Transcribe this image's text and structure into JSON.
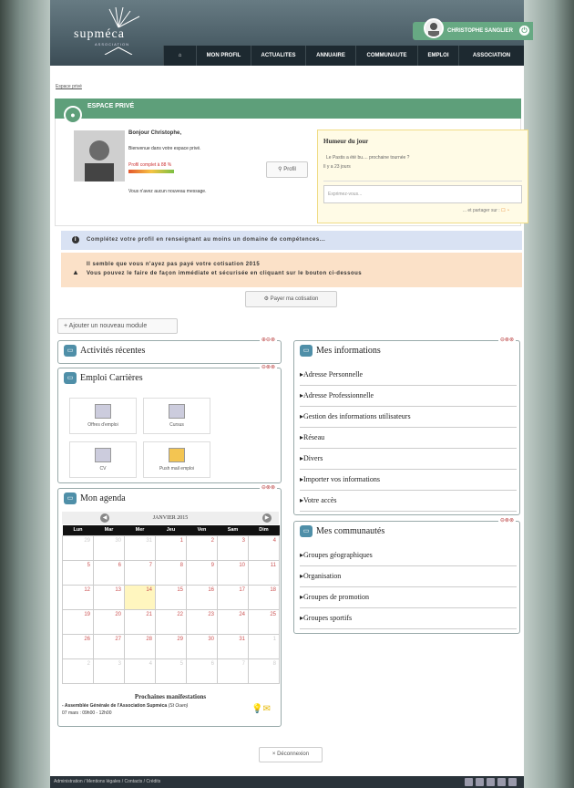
{
  "header": {
    "logo_text": "supméca",
    "logo_sub": "ASSOCIATION",
    "user_name": "CHRISTOPHE SANGLIER"
  },
  "nav": [
    "MON PROFIL",
    "ACTUALITES",
    "ANNUAIRE",
    "COMMUNAUTE",
    "EMPLOI",
    "ASSOCIATION"
  ],
  "breadcrumb": "Espace privé",
  "band_title": "ESPACE PRIVÉ",
  "welcome": {
    "hello": "Bonjour Christophe,",
    "text": "Bienvenue dans votre espace privé.",
    "profile": "Profil complet à 88 %",
    "profile_value": 0.88,
    "messages": "Vous n'avez aucun nouveau message.",
    "profil_btn": "Profil"
  },
  "mood": {
    "title": "Humeur du jour",
    "line1": "Le Pastis a été bu.... prochaine tournée ?",
    "line2": "Il y a 23 jours",
    "placeholder": "Exprimez-vous...",
    "share": "... et partager sur :"
  },
  "info": "Complétez votre profil en renseignant au moins un domaine de compétences...",
  "warn": {
    "a": "Il semble que vous n'ayez pas payé votre cotisation 2015",
    "b": "Vous pouvez le faire de façon immédiate et sécurisée en cliquant sur le bouton ci-dessous"
  },
  "pay": "Payer ma cotisation",
  "add_module": "+ Ajouter un nouveau module",
  "panels": {
    "activites": "Activités récentes",
    "emploi": "Emploi Carrières",
    "agenda": "Mon agenda",
    "infos": "Mes informations",
    "comm": "Mes communautés"
  },
  "emploi_tiles": [
    "Offres d'emploi",
    "Cursus",
    "CV",
    "Push mail emploi"
  ],
  "calendar": {
    "month": "JANVIER 2015",
    "days": [
      "Lun",
      "Mar",
      "Mer",
      "Jeu",
      "Ven",
      "Sam",
      "Dim"
    ],
    "rows": [
      [
        "29",
        "30",
        "31",
        "1",
        "2",
        "3",
        "4"
      ],
      [
        "5",
        "6",
        "7",
        "8",
        "9",
        "10",
        "11"
      ],
      [
        "12",
        "13",
        "14",
        "15",
        "16",
        "17",
        "18"
      ],
      [
        "19",
        "20",
        "21",
        "22",
        "23",
        "24",
        "25"
      ],
      [
        "26",
        "27",
        "28",
        "29",
        "30",
        "31",
        "1"
      ],
      [
        "2",
        "3",
        "4",
        "5",
        "6",
        "7",
        "8"
      ]
    ],
    "next_title": "Prochaines manifestations",
    "event": "- Assemblée Générale de l'Association Supméca",
    "event_place": "(St Ouen)",
    "event_time": "07 mars : 09h00 - 12h00"
  },
  "infos_items": [
    "Adresse Personnelle",
    "Adresse Professionnelle",
    "Gestion des informations utilisateurs",
    "Réseau",
    "Divers",
    "Importer vos informations",
    "Votre accès"
  ],
  "comm_items": [
    "Groupes géographiques",
    "Organisation",
    "Groupes de promotion",
    "Groupes sportifs"
  ],
  "logout": "Déconnexion",
  "footer": "Administration / Mentions légales / Contacts / Crédits",
  "colors": {
    "accent": "#5e9f7a",
    "nav": "#1d2930",
    "info_bg": "#d9e2f3",
    "warn_bg": "#fbe1c8"
  }
}
